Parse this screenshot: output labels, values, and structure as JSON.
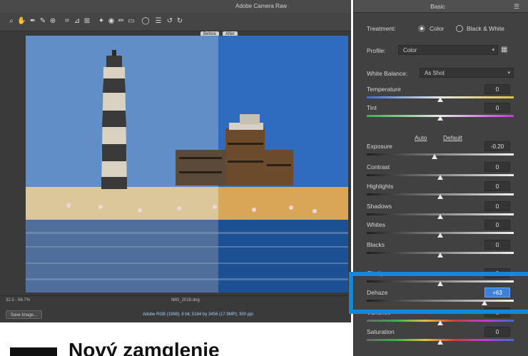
{
  "editor": {
    "title": "Adobe Camera Raw",
    "view_labels": [
      "Before",
      "After"
    ],
    "status": {
      "zoom": "32.5 - 56.7%",
      "file": "IMG_2018.dng",
      "save_label": "Save Image...",
      "info": "Adobe RGB (1998); 8 bit; 5184 by 3456 (17.9MP); 300 ppi"
    }
  },
  "panel": {
    "title": "Basic",
    "treatment": {
      "label": "Treatment:",
      "options": [
        "Color",
        "Black & White"
      ],
      "selected": "Color"
    },
    "profile": {
      "label": "Profile:",
      "value": "Color"
    },
    "white_balance": {
      "label": "White Balance:",
      "value": "As Shot"
    },
    "auto_label": "Auto",
    "default_label": "Default",
    "sliders": [
      {
        "label": "Temperature",
        "value": "0",
        "level": 0.5
      },
      {
        "label": "Tint",
        "value": "0",
        "level": 0.5
      },
      {
        "label": "Exposure",
        "value": "-0.20",
        "level": 0.46
      },
      {
        "label": "Contrast",
        "value": "0",
        "level": 0.5
      },
      {
        "label": "Highlights",
        "value": "0",
        "level": 0.5
      },
      {
        "label": "Shadows",
        "value": "0",
        "level": 0.5
      },
      {
        "label": "Whites",
        "value": "0",
        "level": 0.5
      },
      {
        "label": "Blacks",
        "value": "0",
        "level": 0.5
      },
      {
        "label": "Clarity",
        "value": "0",
        "level": 0.5
      },
      {
        "label": "Dehaze",
        "value": "+63",
        "level": 0.8
      },
      {
        "label": "Vibrance",
        "value": "0",
        "level": 0.5
      },
      {
        "label": "Saturation",
        "value": "0",
        "level": 0.5
      }
    ]
  },
  "article": {
    "heading": "Nový zamglenie"
  },
  "colors": {
    "accent_blue": "#1588d3",
    "active_value": "#3f80d9",
    "panel_bg": "#414141"
  }
}
